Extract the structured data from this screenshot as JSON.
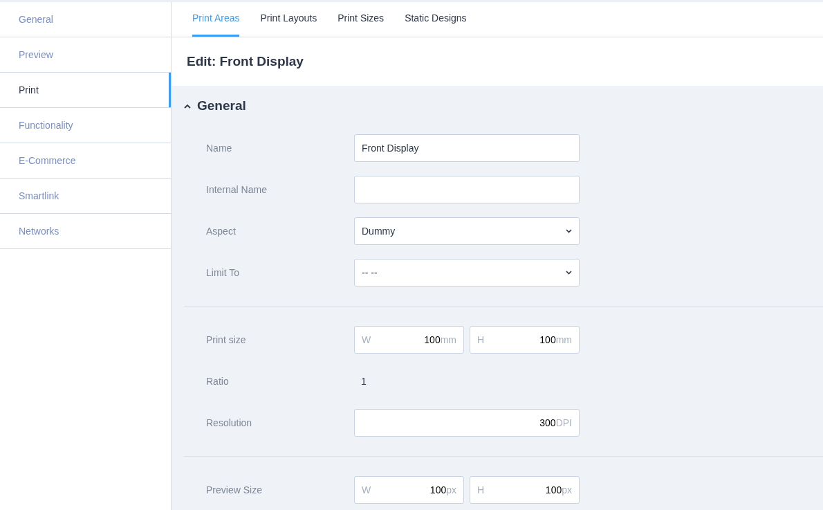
{
  "sidebar": {
    "items": [
      {
        "label": "General",
        "selected": false
      },
      {
        "label": "Preview",
        "selected": false
      },
      {
        "label": "Print",
        "selected": true
      },
      {
        "label": "Functionality",
        "selected": false
      },
      {
        "label": "E-Commerce",
        "selected": false
      },
      {
        "label": "Smartlink",
        "selected": false
      },
      {
        "label": "Networks",
        "selected": false
      }
    ]
  },
  "tabs": [
    {
      "label": "Print Areas",
      "selected": true
    },
    {
      "label": "Print Layouts",
      "selected": false
    },
    {
      "label": "Print Sizes",
      "selected": false
    },
    {
      "label": "Static Designs",
      "selected": false
    }
  ],
  "title": "Edit: Front Display",
  "section": {
    "title": "General",
    "expanded": true,
    "groups": [
      {
        "fields": [
          {
            "kind": "text",
            "label": "Name",
            "value": "Front Display"
          },
          {
            "kind": "text",
            "label": "Internal Name"
          },
          {
            "kind": "select",
            "label": "Aspect",
            "value": "Dummy"
          },
          {
            "kind": "select",
            "label": "Limit To",
            "value": "-- --"
          }
        ]
      },
      {
        "fields": [
          {
            "kind": "size",
            "label": "Print size",
            "width": {
              "prefix": "W",
              "value": "100",
              "unit": "mm"
            },
            "height": {
              "prefix": "H",
              "value": "100",
              "unit": "mm"
            }
          },
          {
            "kind": "static",
            "label": "Ratio",
            "value": "1"
          },
          {
            "kind": "unit",
            "label": "Resolution",
            "value": "300",
            "unit": "DPI"
          }
        ]
      },
      {
        "fields": [
          {
            "kind": "size",
            "label": "Preview Size",
            "width": {
              "prefix": "W",
              "value": "100",
              "unit": "px"
            },
            "height": {
              "prefix": "H",
              "value": "100",
              "unit": "px"
            }
          }
        ]
      }
    ]
  }
}
